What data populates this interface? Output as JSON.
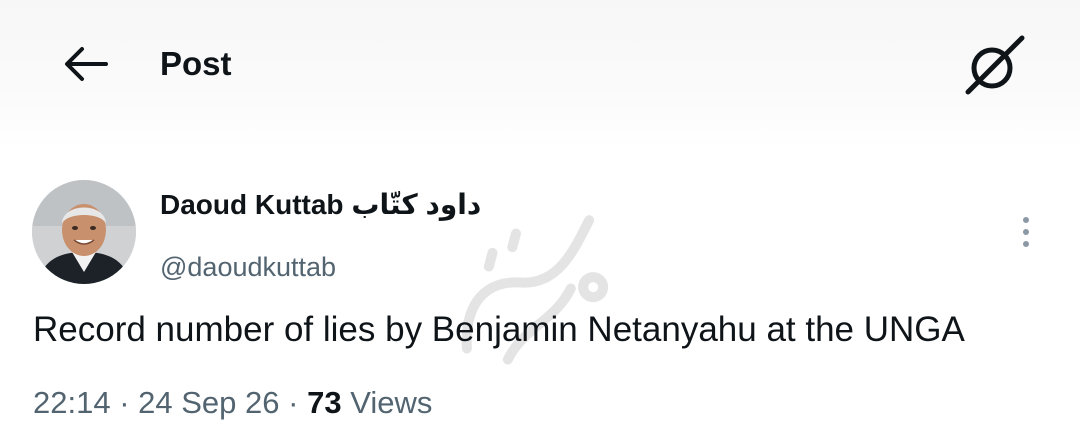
{
  "header": {
    "title": "Post",
    "back_icon": "back-arrow-icon",
    "grok_icon": "grok-icon"
  },
  "post": {
    "author": {
      "display_name": "Daoud Kuttab داود كتّاب",
      "handle": "@daoudkuttab",
      "avatar": "avatar"
    },
    "more_icon": "more-vertical-icon",
    "text": "Record number of lies by Benjamin Netanyahu at the UNGA",
    "meta": {
      "time": "22:14",
      "separator": "·",
      "date": "24 Sep 26",
      "views_count": "73",
      "views_label": "Views"
    }
  },
  "watermark": {
    "text": "فرهیختگان"
  },
  "colors": {
    "text_primary": "#0f1419",
    "text_secondary": "#536471",
    "header_bg": "#f7f7f7"
  }
}
